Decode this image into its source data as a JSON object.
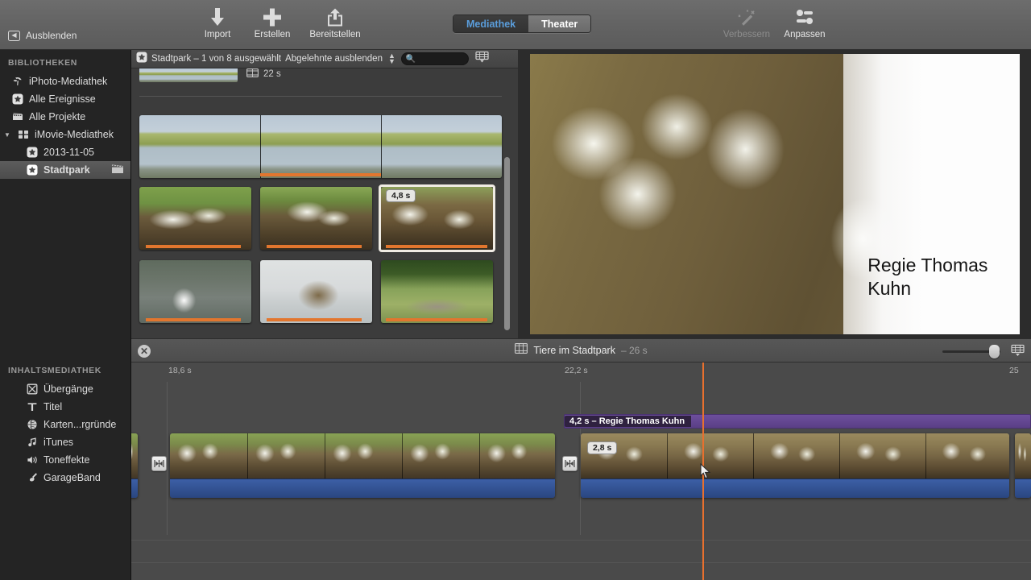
{
  "toolbar": {
    "hide_label": "Ausblenden",
    "hide_icon": "collapse-sidebar-icon",
    "items": [
      {
        "label": "Import",
        "icon": "download-arrow-icon",
        "dim": false
      },
      {
        "label": "Erstellen",
        "icon": "plus-icon",
        "dim": false
      },
      {
        "label": "Bereitstellen",
        "icon": "share-icon",
        "dim": false
      }
    ],
    "right_items": [
      {
        "label": "Verbessern",
        "icon": "magic-wand-icon",
        "dim": true
      },
      {
        "label": "Anpassen",
        "icon": "adjust-sliders-icon",
        "dim": false
      }
    ],
    "segmented": {
      "left": "Mediathek",
      "right": "Theater",
      "selected": "Mediathek"
    }
  },
  "sidebar": {
    "libraries_header": "BIBLIOTHEKEN",
    "library_items": [
      {
        "label": "iPhoto-Mediathek",
        "icon": "iphoto-icon",
        "indent": false,
        "disclosure": "",
        "selected": false,
        "trailing": ""
      },
      {
        "label": "Alle Ereignisse",
        "icon": "star-event-icon",
        "indent": false,
        "disclosure": "",
        "selected": false,
        "trailing": ""
      },
      {
        "label": "Alle Projekte",
        "icon": "projects-filmstrip-icon",
        "indent": false,
        "disclosure": "",
        "selected": false,
        "trailing": ""
      },
      {
        "label": "iMovie-Mediathek",
        "icon": "imovie-library-icon",
        "indent": false,
        "disclosure": "▼",
        "selected": false,
        "trailing": ""
      },
      {
        "label": "2013-11-05",
        "icon": "star-event-icon",
        "indent": true,
        "disclosure": "",
        "selected": false,
        "trailing": ""
      },
      {
        "label": "Stadtpark",
        "icon": "star-event-icon",
        "indent": true,
        "disclosure": "",
        "selected": true,
        "trailing": "clapperboard-icon"
      }
    ],
    "content_header": "INHALTSMEDIATHEK",
    "content_items": [
      {
        "label": "Übergänge",
        "icon": "transitions-icon"
      },
      {
        "label": "Titel",
        "icon": "title-T-icon"
      },
      {
        "label": "Karten...rgründe",
        "icon": "globe-icon"
      },
      {
        "label": "iTunes",
        "icon": "music-note-icon"
      },
      {
        "label": "Toneffekte",
        "icon": "speaker-icon"
      },
      {
        "label": "GarageBand",
        "icon": "guitar-icon"
      }
    ]
  },
  "browser": {
    "event_icon": "star-event-icon",
    "title": "Stadtpark – 1 von 8 ausgewählt",
    "filter_label": "Abgelehnte ausblenden",
    "search_placeholder": "",
    "search_value": "",
    "search_icon": "search-icon",
    "filmstrip_icon": "filmstrip-view-icon",
    "partial_clip_duration": "22 s",
    "duration_icon": "clip-duration-icon",
    "clips": [
      {
        "name": "lake-panorama-clip",
        "duration": "",
        "selected": false,
        "photo": "ph-lake",
        "frames": 3
      },
      {
        "name": "butterflies-grass-clip",
        "duration": "",
        "selected": false,
        "photo": "ph-butterfly",
        "frames": 1
      },
      {
        "name": "butterflies-soil-clip",
        "duration": "",
        "selected": false,
        "photo": "ph-butterfly2",
        "frames": 1
      },
      {
        "name": "butterflies-selected-clip",
        "duration": "4,8 s",
        "selected": true,
        "photo": "ph-butterfly3",
        "frames": 1
      },
      {
        "name": "swan-clip",
        "duration": "",
        "selected": false,
        "photo": "ph-swan",
        "frames": 1
      },
      {
        "name": "duck-preening-clip",
        "duration": "",
        "selected": false,
        "photo": "ph-duck",
        "frames": 1
      },
      {
        "name": "ducks-meadow-clip",
        "duration": "",
        "selected": false,
        "photo": "ph-ducks",
        "frames": 1
      }
    ]
  },
  "viewer": {
    "title_overlay_line1": "Regie Thomas",
    "title_overlay_line2": "Kuhn"
  },
  "timeline": {
    "close_label": "✕",
    "project_icon": "project-filmstrip-icon",
    "project_name": "Tiere im Stadtpark",
    "project_duration": "– 26 s",
    "zoom_icon": "zoom-slider",
    "settings_icon": "timeline-settings-icon",
    "ruler_ticks": [
      "18,6 s",
      "22,2 s",
      "25"
    ],
    "title_clip": {
      "duration": "4,2 s",
      "separator": "–",
      "text": "Regie Thomas Kuhn",
      "full": "4,2 s –  Regie Thomas Kuhn"
    },
    "clips": [
      {
        "name": "timeline-clip-left-partial",
        "duration": ""
      },
      {
        "name": "timeline-clip-butterflies-a",
        "duration": ""
      },
      {
        "name": "timeline-clip-butterflies-b",
        "duration": "2,8 s"
      },
      {
        "name": "timeline-clip-right-partial",
        "duration": ""
      }
    ],
    "transition_icon": "transition-icon"
  }
}
